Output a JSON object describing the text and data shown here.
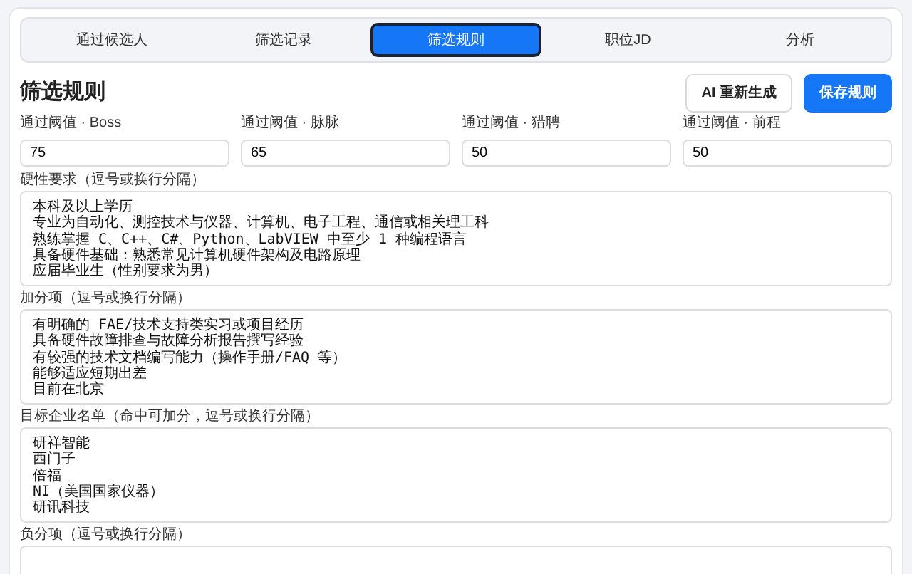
{
  "tabs": [
    {
      "label": "通过候选人",
      "selected": false
    },
    {
      "label": "筛选记录",
      "selected": false
    },
    {
      "label": "筛选规则",
      "selected": true
    },
    {
      "label": "职位JD",
      "selected": false
    },
    {
      "label": "分析",
      "selected": false
    }
  ],
  "heading": "筛选规则",
  "buttons": [
    {
      "label": "AI 重新生成",
      "kind": "secondary"
    },
    {
      "label": "保存规则",
      "kind": "primary"
    }
  ],
  "thresholds": [
    {
      "label": "通过阈值 · Boss",
      "value": "75"
    },
    {
      "label": "通过阈值 · 脉脉",
      "value": "65"
    },
    {
      "label": "通过阈值 · 猎聘",
      "value": "50"
    },
    {
      "label": "通过阈值 · 前程",
      "value": "50"
    }
  ],
  "text_areas": [
    {
      "label": "硬性要求（逗号或换行分隔）",
      "lines": [
        "本科及以上学历",
        "专业为自动化、测控技术与仪器、计算机、电子工程、通信或相关理工科",
        "熟练掌握 C、C++、C#、Python、LabVIEW 中至少 1 种编程语言",
        "具备硬件基础：熟悉常见计算机硬件架构及电路原理",
        "应届毕业生（性别要求为男）"
      ]
    },
    {
      "label": "加分项（逗号或换行分隔）",
      "lines": [
        "有明确的 FAE/技术支持类实习或项目经历",
        "具备硬件故障排查与故障分析报告撰写经验",
        "有较强的技术文档编写能力（操作手册/FAQ 等）",
        "能够适应短期出差",
        "目前在北京"
      ]
    },
    {
      "label": "目标企业名单（命中可加分，逗号或换行分隔）",
      "lines": [
        "研祥智能",
        "西门子",
        "倍福",
        "NI（美国国家仪器）",
        "研讯科技"
      ]
    },
    {
      "label": "负分项（逗号或换行分隔）"
    }
  ]
}
